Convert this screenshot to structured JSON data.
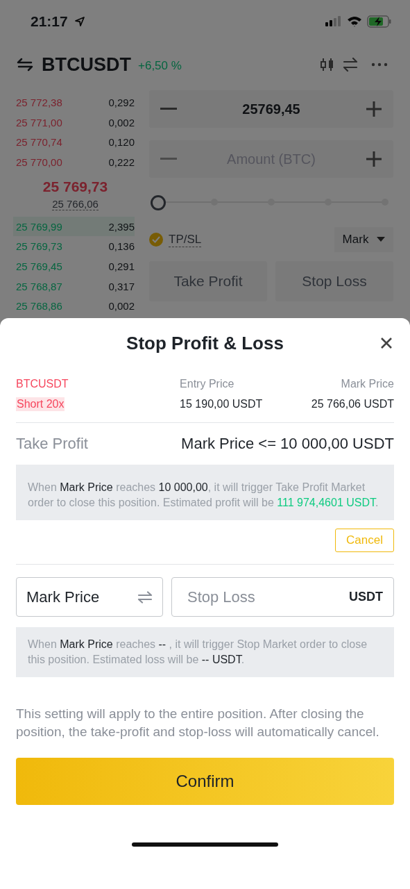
{
  "status_bar": {
    "time": "21:17"
  },
  "header": {
    "symbol": "BTCUSDT",
    "change": "+6,50 %"
  },
  "order_book": {
    "asks": [
      {
        "price": "25 772,38",
        "qty": "0,292"
      },
      {
        "price": "25 771,00",
        "qty": "0,002"
      },
      {
        "price": "25 770,74",
        "qty": "0,120"
      },
      {
        "price": "25 770,00",
        "qty": "0,222"
      }
    ],
    "last_price": "25 769,73",
    "mark_price": "25 766,06",
    "bids": [
      {
        "price": "25 769,99",
        "qty": "2,395",
        "highlighted": true
      },
      {
        "price": "25 769,73",
        "qty": "0,136",
        "highlighted": false
      },
      {
        "price": "25 769,45",
        "qty": "0,291",
        "highlighted": false
      },
      {
        "price": "25 768,87",
        "qty": "0,317",
        "highlighted": false
      },
      {
        "price": "25 768,86",
        "qty": "0,002",
        "highlighted": false
      }
    ]
  },
  "order_form": {
    "price": "25769,45",
    "amount_placeholder": "Amount (BTC)",
    "leverage": {
      "level": 0
    },
    "tpsl": {
      "label": "TP/SL",
      "checked": true
    },
    "price_type": "Mark",
    "buttons": [
      "Take Profit",
      "Stop Loss"
    ]
  },
  "sheet": {
    "title": "Stop Profit & Loss",
    "position": {
      "symbol": "BTCUSDT",
      "side": "Short 20x",
      "entry_label": "Entry Price",
      "entry_value": "15 190,00 USDT",
      "mark_label": "Mark Price",
      "mark_value": "25 766,06 USDT"
    },
    "take_profit": {
      "label": "Take Profit",
      "condition": "Mark Price <= 10 000,00 USDT",
      "info": "When **Mark Price** reaches **10 000,00**, it will trigger Take Profit Market order to close this position. Estimated profit will be *111 974,4601 USDT*.",
      "cancel": "Cancel"
    },
    "stop_loss": {
      "trigger": "Mark Price",
      "placeholder": "Stop Loss",
      "unit": "USDT",
      "info": "When **Mark Price** reaches **--** , it will trigger Stop Market order to close this position. Estimated loss will be **-- USDT**."
    },
    "note": "This setting will apply to the entire position. After closing the position, the take-profit and stop-loss will automatically cancel.",
    "confirm": "Confirm"
  }
}
